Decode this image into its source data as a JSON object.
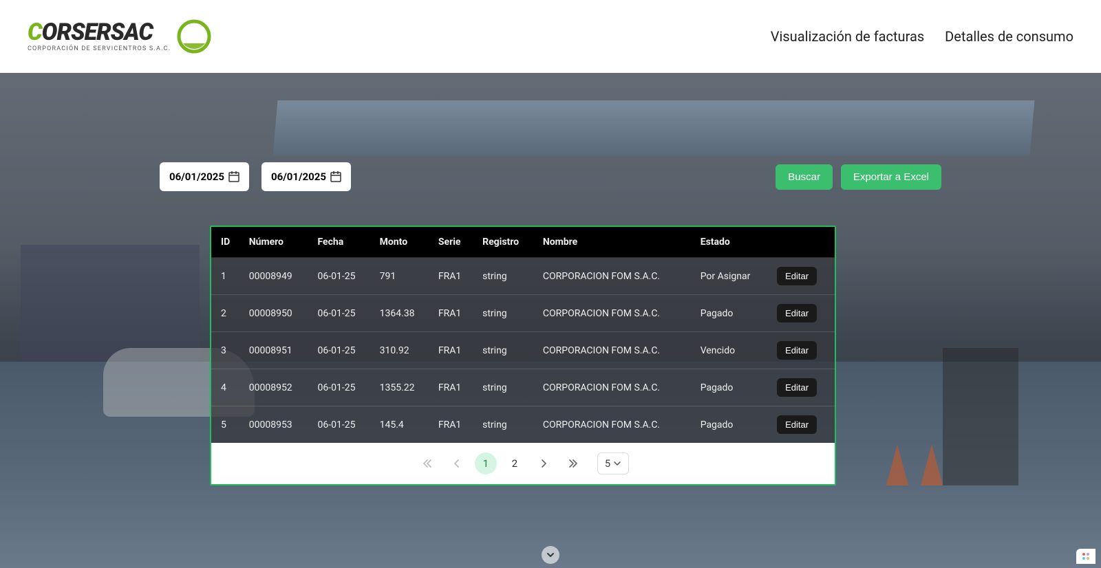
{
  "brand": {
    "name_part1": "C",
    "name_part2": "O",
    "name_part3": "RSERSAC",
    "tagline": "CORPORACIÓN DE SERVICENTROS S.A.C."
  },
  "nav": {
    "item1": "Visualización de facturas",
    "item2": "Detalles de consumo"
  },
  "filters": {
    "date_from": "06/01/2025",
    "date_to": "06/01/2025",
    "search_label": "Buscar",
    "export_label": "Exportar a Excel"
  },
  "table": {
    "headers": {
      "id": "ID",
      "numero": "Número",
      "fecha": "Fecha",
      "monto": "Monto",
      "serie": "Serie",
      "registro": "Registro",
      "nombre": "Nombre",
      "estado": "Estado"
    },
    "edit_label": "Editar",
    "rows": [
      {
        "id": "1",
        "numero": "00008949",
        "fecha": "06-01-25",
        "monto": "791",
        "serie": "FRA1",
        "registro": "string",
        "nombre": "CORPORACION FOM S.A.C.",
        "estado": "Por Asignar"
      },
      {
        "id": "2",
        "numero": "00008950",
        "fecha": "06-01-25",
        "monto": "1364.38",
        "serie": "FRA1",
        "registro": "string",
        "nombre": "CORPORACION FOM S.A.C.",
        "estado": "Pagado"
      },
      {
        "id": "3",
        "numero": "00008951",
        "fecha": "06-01-25",
        "monto": "310.92",
        "serie": "FRA1",
        "registro": "string",
        "nombre": "CORPORACION FOM S.A.C.",
        "estado": "Vencido"
      },
      {
        "id": "4",
        "numero": "00008952",
        "fecha": "06-01-25",
        "monto": "1355.22",
        "serie": "FRA1",
        "registro": "string",
        "nombre": "CORPORACION FOM S.A.C.",
        "estado": "Pagado"
      },
      {
        "id": "5",
        "numero": "00008953",
        "fecha": "06-01-25",
        "monto": "145.4",
        "serie": "FRA1",
        "registro": "string",
        "nombre": "CORPORACION FOM S.A.C.",
        "estado": "Pagado"
      }
    ]
  },
  "pagination": {
    "page1": "1",
    "page2": "2",
    "size": "5"
  }
}
